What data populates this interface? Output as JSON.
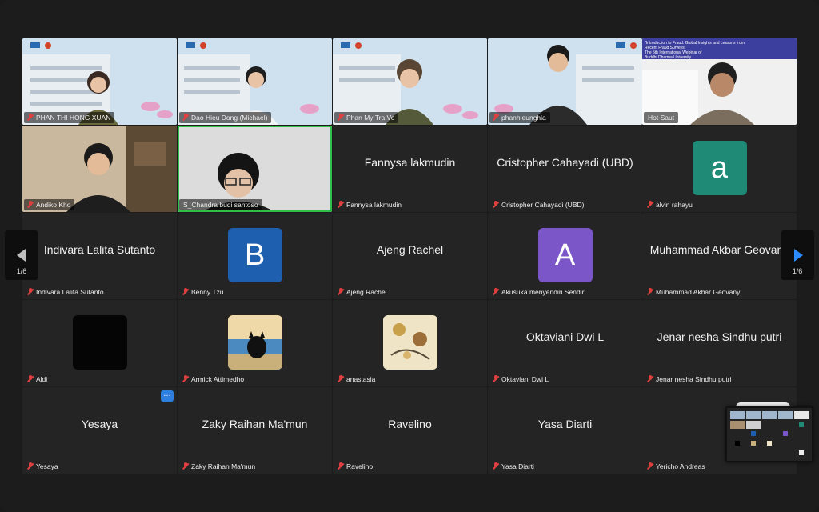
{
  "tiles": [
    {
      "name": "PHAN THI HONG XUAN"
    },
    {
      "name": "Dao Hieu Dong (Michael)"
    },
    {
      "name": "Phan My Tra Vo"
    },
    {
      "name": "phanhieunghia"
    },
    {
      "name": "Hot Saut"
    },
    {
      "name": "Andiko Kho"
    },
    {
      "name": "S_Chandra budi santoso"
    },
    {
      "name": "Fannysa lakmudin"
    },
    {
      "name": "Cristopher Cahayadi (UBD)"
    },
    {
      "name": "alvin rahayu",
      "letter": "a",
      "color": "#1f8a76"
    },
    {
      "name": "Indivara Lalita Sutanto"
    },
    {
      "name": "Benny Tzu",
      "letter": "B",
      "color": "#1f5fb0"
    },
    {
      "name": "Ajeng Rachel"
    },
    {
      "name": "Akusuka menyendiri Sendiri",
      "letter": "A",
      "color": "#7b56c8"
    },
    {
      "name": "Muhammad Akbar Geovany"
    },
    {
      "name": "Aldi"
    },
    {
      "name": "Armick Attimedho"
    },
    {
      "name": "anastasia"
    },
    {
      "name": "Oktaviani Dwi L"
    },
    {
      "name": "Jenar nesha Sindhu putri"
    },
    {
      "name": "Yesaya"
    },
    {
      "name": "Zaky Raihan Ma'mun"
    },
    {
      "name": "Ravelino"
    },
    {
      "name": "Yasa Diarti"
    },
    {
      "name": "Yericho Andreas"
    }
  ],
  "banner": {
    "line1": "\"Introduction to Fraud: Global Insights and Lessons from Recent Fraud Surveys\"",
    "line2": "The 5th International Webinar of",
    "line3": "Buddhi Dharma University"
  },
  "pagination": {
    "left": "1/6",
    "right": "1/6"
  },
  "more_label": "…"
}
